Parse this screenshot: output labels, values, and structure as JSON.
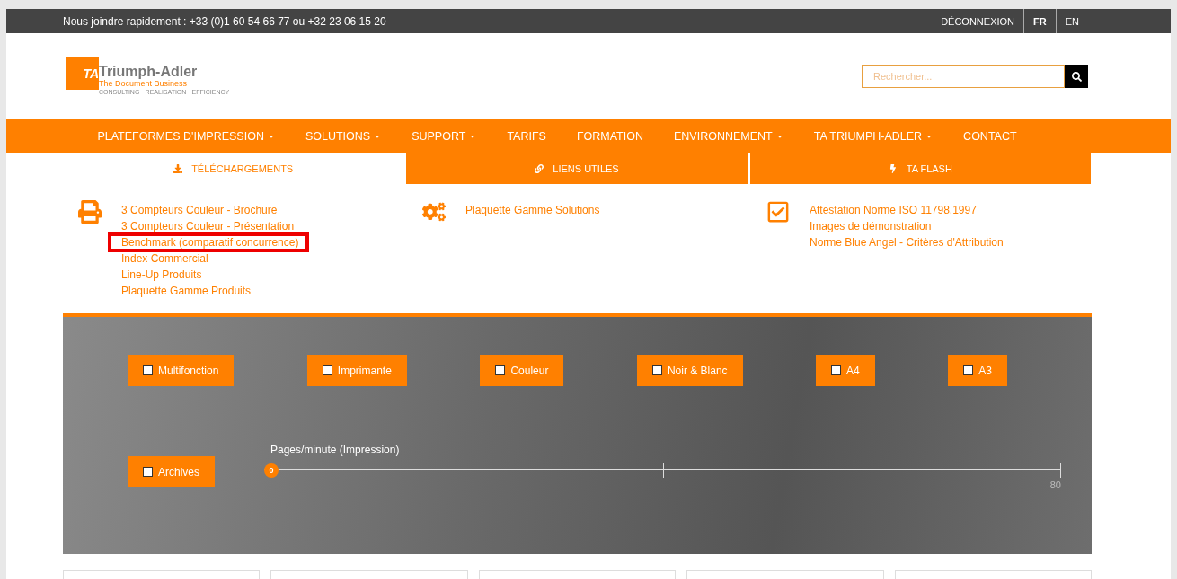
{
  "top_bar": {
    "contact": "Nous joindre rapidement : +33 (0)1 60 54 66 77 ou +32 23 06 15 20",
    "links": [
      {
        "label": "DÉCONNEXION",
        "selected": false
      },
      {
        "label": "FR",
        "selected": true
      },
      {
        "label": "EN",
        "selected": false
      }
    ]
  },
  "logo": {
    "mark": "TA",
    "name": "Triumph-Adler",
    "tagline": "The Document Business",
    "subline": "CONSULTING · REALISATION · EFFICIENCY"
  },
  "search": {
    "placeholder": "Rechercher..."
  },
  "nav": [
    {
      "label": "PLATEFORMES D'IMPRESSION",
      "dropdown": true
    },
    {
      "label": "SOLUTIONS",
      "dropdown": true
    },
    {
      "label": "SUPPORT",
      "dropdown": true
    },
    {
      "label": "TARIFS",
      "dropdown": false
    },
    {
      "label": "FORMATION",
      "dropdown": false
    },
    {
      "label": "ENVIRONNEMENT",
      "dropdown": true
    },
    {
      "label": "TA TRIUMPH-ADLER",
      "dropdown": true
    },
    {
      "label": "CONTACT",
      "dropdown": false
    }
  ],
  "tabs": [
    {
      "label": "TÉLÉCHARGEMENTS",
      "kind": "download",
      "selected": true
    },
    {
      "label": "LIENS UTILES",
      "kind": "link",
      "selected": false
    },
    {
      "label": "TA FLASH",
      "kind": "flash",
      "selected": false
    }
  ],
  "groups": [
    {
      "kind": "printer",
      "links": [
        {
          "label": "3 Compteurs Couleur - Brochure",
          "highlighted": false
        },
        {
          "label": "3 Compteurs Couleur - Présentation",
          "highlighted": false
        },
        {
          "label": "Benchmark (comparatif concurrence)",
          "highlighted": true
        },
        {
          "label": "Index Commercial",
          "highlighted": false
        },
        {
          "label": "Line-Up Produits",
          "highlighted": false
        },
        {
          "label": "Plaquette Gamme Produits",
          "highlighted": false
        }
      ]
    },
    {
      "kind": "gears",
      "links": [
        {
          "label": "Plaquette Gamme Solutions",
          "highlighted": false
        }
      ]
    },
    {
      "kind": "check",
      "links": [
        {
          "label": "Attestation Norme ISO 11798.1997",
          "highlighted": false
        },
        {
          "label": "Images de démonstration",
          "highlighted": false
        },
        {
          "label": "Norme Blue Angel - Critères d'Attribution",
          "highlighted": false
        }
      ]
    }
  ],
  "filters": [
    {
      "label": "Multifonction",
      "checked": false
    },
    {
      "label": "Imprimante",
      "checked": false
    },
    {
      "label": "Couleur",
      "checked": false
    },
    {
      "label": "Noir & Blanc",
      "checked": false
    },
    {
      "label": "A4",
      "checked": false
    },
    {
      "label": "A3",
      "checked": false
    },
    {
      "label": "Archives",
      "checked": false
    }
  ],
  "slider": {
    "label": "Pages/minute (Impression)",
    "value": "0",
    "max": "80",
    "level": 0
  }
}
